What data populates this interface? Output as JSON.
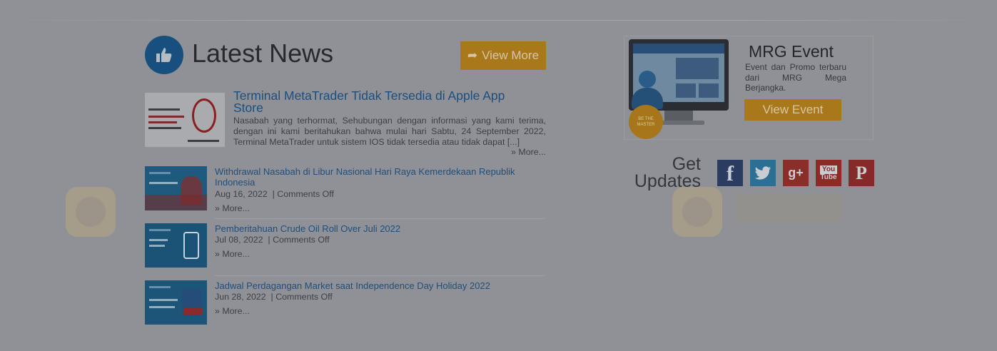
{
  "news": {
    "title": "Latest News",
    "view_more_label": "View More",
    "featured": {
      "title": "Terminal MetaTrader Tidak Tersedia di Apple App Store",
      "excerpt": "Nasabah yang terhormat, Sehubungan dengan informasi yang kami terima, dengan ini kami beritahukan bahwa mulai hari Sabtu, 24 September 2022, Terminal MetaTrader untuk sistem IOS tidak tersedia atau tidak dapat [...]",
      "more_label": "» More..."
    },
    "items": [
      {
        "title": "Withdrawal Nasabah di Libur Nasional Hari Raya Kemerdekaan Republik Indonesia",
        "date": "Aug 16, 2022",
        "comments": "Comments Off",
        "more_label": "» More..."
      },
      {
        "title": "Pemberitahuan Crude Oil Roll Over Juli 2022",
        "date": "Jul 08, 2022",
        "comments": "Comments Off",
        "more_label": "» More..."
      },
      {
        "title": "Jadwal Perdagangan Market saat Independence Day Holiday 2022",
        "date": "Jun 28, 2022",
        "comments": "Comments Off",
        "more_label": "» More..."
      }
    ]
  },
  "event": {
    "title": "MRG Event",
    "description": "Event dan Promo terbaru dari MRG Mega Berjangka.",
    "button_label": "View Event",
    "badge_text": "BE THE MASTER"
  },
  "updates": {
    "line1": "Get",
    "line2": "Updates",
    "socials": [
      {
        "name": "facebook-icon",
        "glyph": "f"
      },
      {
        "name": "twitter-icon",
        "glyph": "t"
      },
      {
        "name": "google-plus-icon",
        "glyph": "g+"
      },
      {
        "name": "youtube-icon",
        "glyph": "You Tube"
      },
      {
        "name": "pinterest-icon",
        "glyph": "P"
      }
    ]
  },
  "colors": {
    "overlay_bg": "#8f9196",
    "accent": "#a8781a",
    "link": "#1c4f7f"
  }
}
